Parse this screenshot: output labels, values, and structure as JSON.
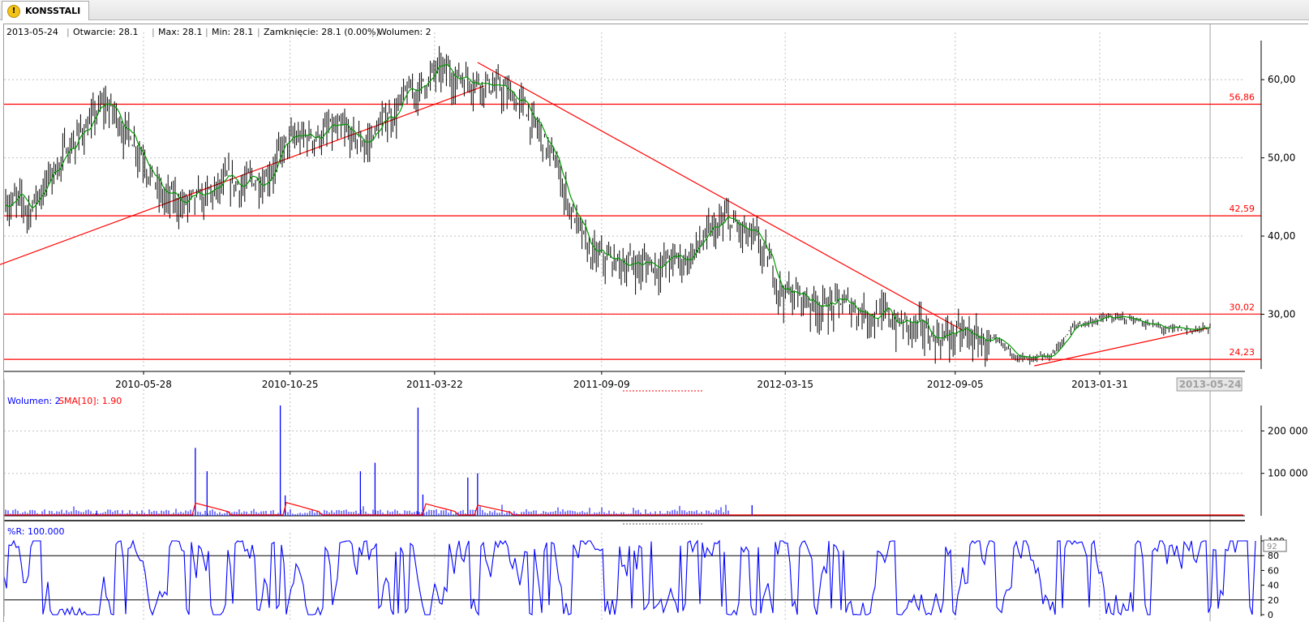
{
  "tab": {
    "label": "KONSSTALI",
    "icon": "warning-icon"
  },
  "info_bar": {
    "date": "2013-05-24",
    "open_label": "Otwarcie: 28.1",
    "max_label": "Max: 28.1",
    "min_label": "Min: 28.1",
    "close_label": "Zamknięcie: 28.1 (0.00%)",
    "volume_label": "Wolumen: 2"
  },
  "volume_legend": {
    "volume": "Wolumen: 2",
    "sma": "SMA[10]: 1.90"
  },
  "wr_legend": "%R: 100.000",
  "wr_value_box": "92",
  "colors": {
    "price_bar": "#000000",
    "ma_line": "#009900",
    "levels": "#ff0000",
    "volume": "#0000ff",
    "sma": "#ff0000",
    "wr": "#0000ff",
    "grid": "#c0c0c0"
  },
  "chart_data": [
    {
      "type": "line",
      "title": "",
      "x_ticks": [
        "2010-05-28",
        "2010-10-25",
        "2011-03-22",
        "2011-09-09",
        "2012-03-15",
        "2012-09-05",
        "2013-01-31",
        "2013-05-24"
      ],
      "y_ticks": [
        "30,00",
        "40,00",
        "50,00",
        "60,00"
      ],
      "ylim": [
        23,
        65
      ],
      "horizontal_levels": [
        {
          "label": "56,86",
          "value": 56.86
        },
        {
          "label": "42,59",
          "value": 42.59
        },
        {
          "label": "30,02",
          "value": 30.02
        },
        {
          "label": "24,23",
          "value": 24.23
        }
      ],
      "trend_lines": [
        {
          "from": {
            "x": "2009-12-20",
            "y": 35.8
          },
          "to": {
            "x": "2011-05-12",
            "y": 59.2
          }
        },
        {
          "from": {
            "x": "2011-05-05",
            "y": 62.2
          },
          "to": {
            "x": "2012-09-12",
            "y": 28.0
          }
        },
        {
          "from": {
            "x": "2012-11-25",
            "y": 23.4
          },
          "to": {
            "x": "2013-05-24",
            "y": 28.3
          }
        }
      ],
      "series": [
        {
          "x": [
            "2009-12-20",
            "2010-01-30",
            "2010-03-15",
            "2010-04-20",
            "2010-05-28",
            "2010-06-15",
            "2010-07-20",
            "2010-08-20",
            "2010-09-20",
            "2010-10-25",
            "2010-12-01",
            "2011-01-10",
            "2011-02-10",
            "2011-03-22",
            "2011-05-05",
            "2011-06-20",
            "2011-07-25",
            "2011-08-25",
            "2011-09-09",
            "2011-10-20",
            "2011-12-01",
            "2012-01-15",
            "2012-02-15",
            "2012-03-15",
            "2012-04-20",
            "2012-05-30",
            "2012-07-10",
            "2012-08-10",
            "2012-09-05",
            "2012-10-15",
            "2012-11-20",
            "2012-12-10",
            "2013-01-05",
            "2013-01-31",
            "2013-03-05",
            "2013-04-10",
            "2013-05-24"
          ],
          "values": [
            46.5,
            43.5,
            52.0,
            57.0,
            51.0,
            45.0,
            44.0,
            46.5,
            47.0,
            52.0,
            53.5,
            52.0,
            56.5,
            61.0,
            60.5,
            57.0,
            49.0,
            38.0,
            37.0,
            36.5,
            37.0,
            42.0,
            39.0,
            33.0,
            31.5,
            31.0,
            29.0,
            27.5,
            27.5,
            26.5,
            24.0,
            24.5,
            28.5,
            29.5,
            29.5,
            28.0,
            28.2
          ]
        }
      ]
    },
    {
      "type": "bar",
      "title": "",
      "y_ticks": [
        "100 000",
        "200 000"
      ],
      "ylim": [
        0,
        260000
      ],
      "series": [
        {
          "name": "Wolumen",
          "x": [
            "2010-04-10",
            "2010-07-20",
            "2010-08-01",
            "2010-10-15",
            "2010-10-20",
            "2011-01-05",
            "2011-01-20",
            "2011-03-05",
            "2011-03-10",
            "2011-04-25",
            "2011-05-05",
            "2012-02-10"
          ],
          "values": [
            12000,
            160000,
            105000,
            260000,
            48000,
            105000,
            125000,
            255000,
            50000,
            90000,
            100000,
            25000
          ]
        },
        {
          "name": "SMA[10]",
          "x": [
            "2010-07-20",
            "2010-10-20",
            "2011-03-10",
            "2011-05-05",
            "2013-05-24"
          ],
          "values": [
            30000,
            32000,
            30000,
            25000,
            1.9
          ]
        }
      ]
    },
    {
      "type": "line",
      "title": "",
      "y_ticks": [
        "0",
        "20",
        "40",
        "60",
        "80",
        "100"
      ],
      "ylim": [
        0,
        100
      ],
      "horizontal_levels": [
        {
          "value": 80
        },
        {
          "value": 20
        }
      ],
      "series": [
        {
          "name": "%R",
          "x": [
            "2013-05-24"
          ],
          "values": [
            100.0
          ]
        }
      ]
    }
  ]
}
